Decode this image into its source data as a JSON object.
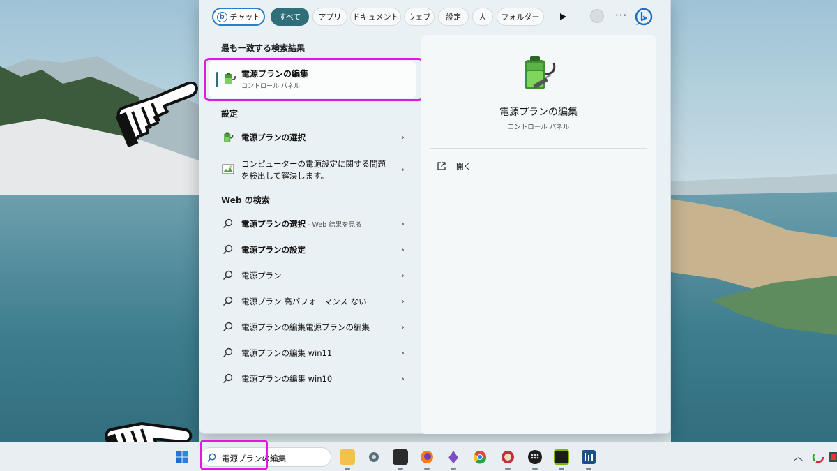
{
  "filter_bar": {
    "chat_label": "チャット",
    "tabs": [
      {
        "label": "すべて",
        "active": true
      },
      {
        "label": "アプリ",
        "active": false
      },
      {
        "label": "ドキュメント",
        "active": false
      },
      {
        "label": "ウェブ",
        "active": false
      },
      {
        "label": "設定",
        "active": false
      },
      {
        "label": "人",
        "active": false
      },
      {
        "label": "フォルダー",
        "active": false
      }
    ],
    "more_label": "···",
    "bing_letter": "b"
  },
  "best_match": {
    "section_title": "最も一致する検索結果",
    "name": "電源プランの編集",
    "subtitle": "コントロール パネル",
    "icon": "power-plan-icon"
  },
  "settings": {
    "section_title": "設定",
    "items": [
      {
        "label": "電源プランの選択",
        "icon": "power-plan-icon"
      },
      {
        "line1": "コンピューターの電源設定に関する問題",
        "line2": "を検出して解決します。",
        "icon": "troubleshoot-icon"
      }
    ]
  },
  "web": {
    "section_title": "Web の検索",
    "items": [
      {
        "query": "電源プランの選択",
        "hint": " - Web 結果を見る"
      },
      {
        "query": "電源プランの設定",
        "hint": ""
      },
      {
        "query": "電源プラン",
        "hint": ""
      },
      {
        "query": "電源プラン 高パフォーマンス ない",
        "hint": ""
      },
      {
        "query": "電源プランの編集電源プランの編集",
        "hint": ""
      },
      {
        "query": "電源プランの編集 win11",
        "hint": ""
      },
      {
        "query": "電源プランの編集 win10",
        "hint": ""
      }
    ]
  },
  "preview": {
    "title": "電源プランの編集",
    "subtitle": "コントロール パネル",
    "actions": [
      {
        "label": "開く",
        "icon": "open-external-icon"
      }
    ]
  },
  "taskbar": {
    "search_text": "電源プランの編集",
    "apps": [
      "file-explorer-icon",
      "settings-gear-icon",
      "terminal-icon",
      "firefox-icon",
      "purple-app-icon",
      "chrome-icon",
      "red-app-icon",
      "calculator-icon",
      "nvidia-icon",
      "monitor-app-icon"
    ],
    "tray": [
      "chevron-up-icon",
      "color-app-icon",
      "tray-app-icon"
    ]
  },
  "colors": {
    "accent": "#2f6f79",
    "highlight": "#e019e0",
    "bing_blue": "#1d6fc2"
  }
}
